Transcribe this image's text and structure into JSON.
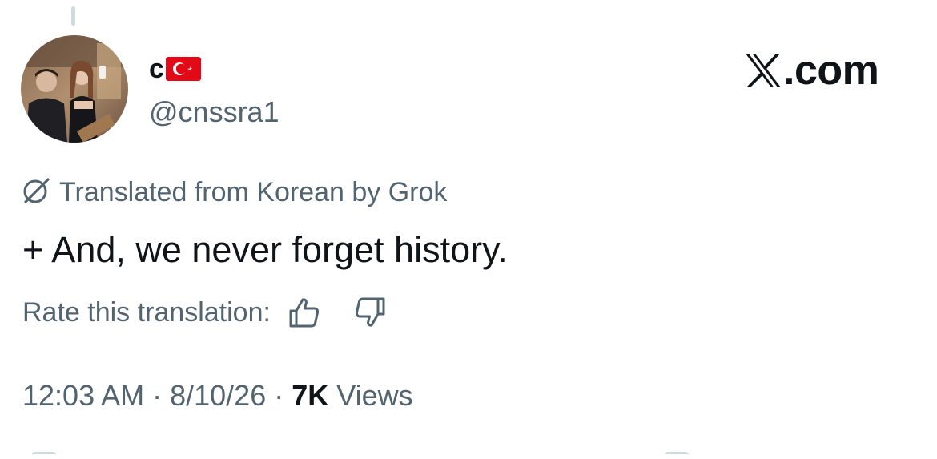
{
  "author": {
    "display_name": "c",
    "flag": "turkey-flag-icon",
    "handle": "@cnssra1",
    "avatar": "profile-photo"
  },
  "brand": {
    "mark": "x-logo-icon",
    "domain": ".com"
  },
  "translation": {
    "icon": "grok-icon",
    "notice": "Translated from Korean by Grok"
  },
  "tweet": {
    "text": "+ And, we never forget history."
  },
  "rating": {
    "label": "Rate this translation:",
    "up_icon": "thumbs-up-icon",
    "down_icon": "thumbs-down-icon"
  },
  "meta": {
    "time": "12:03 AM",
    "separator": " · ",
    "date": "8/10/26",
    "views_count": "7K",
    "views_label": " Views"
  },
  "colors": {
    "text_primary": "#0f1419",
    "text_secondary": "#536471",
    "flag_red": "#e30a17"
  }
}
